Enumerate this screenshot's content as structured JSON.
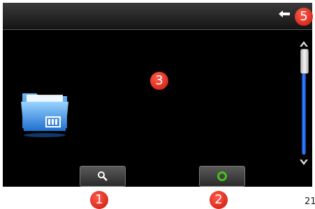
{
  "badges": {
    "search": "1",
    "confirm": "2",
    "list_area": "3",
    "back": "5"
  },
  "top_bar": {
    "back_icon": "back-arrow-icon"
  },
  "list": {
    "items": [
      {
        "icon": "video-folder-icon"
      }
    ]
  },
  "buttons": {
    "search_icon": "search-icon",
    "confirm_icon": "ring-icon",
    "ring_color": "#46c01a"
  },
  "scrollbar": {
    "up_icon": "chevron-up-icon",
    "down_icon": "chevron-down-icon",
    "position": 0.0
  },
  "page_number": "21"
}
